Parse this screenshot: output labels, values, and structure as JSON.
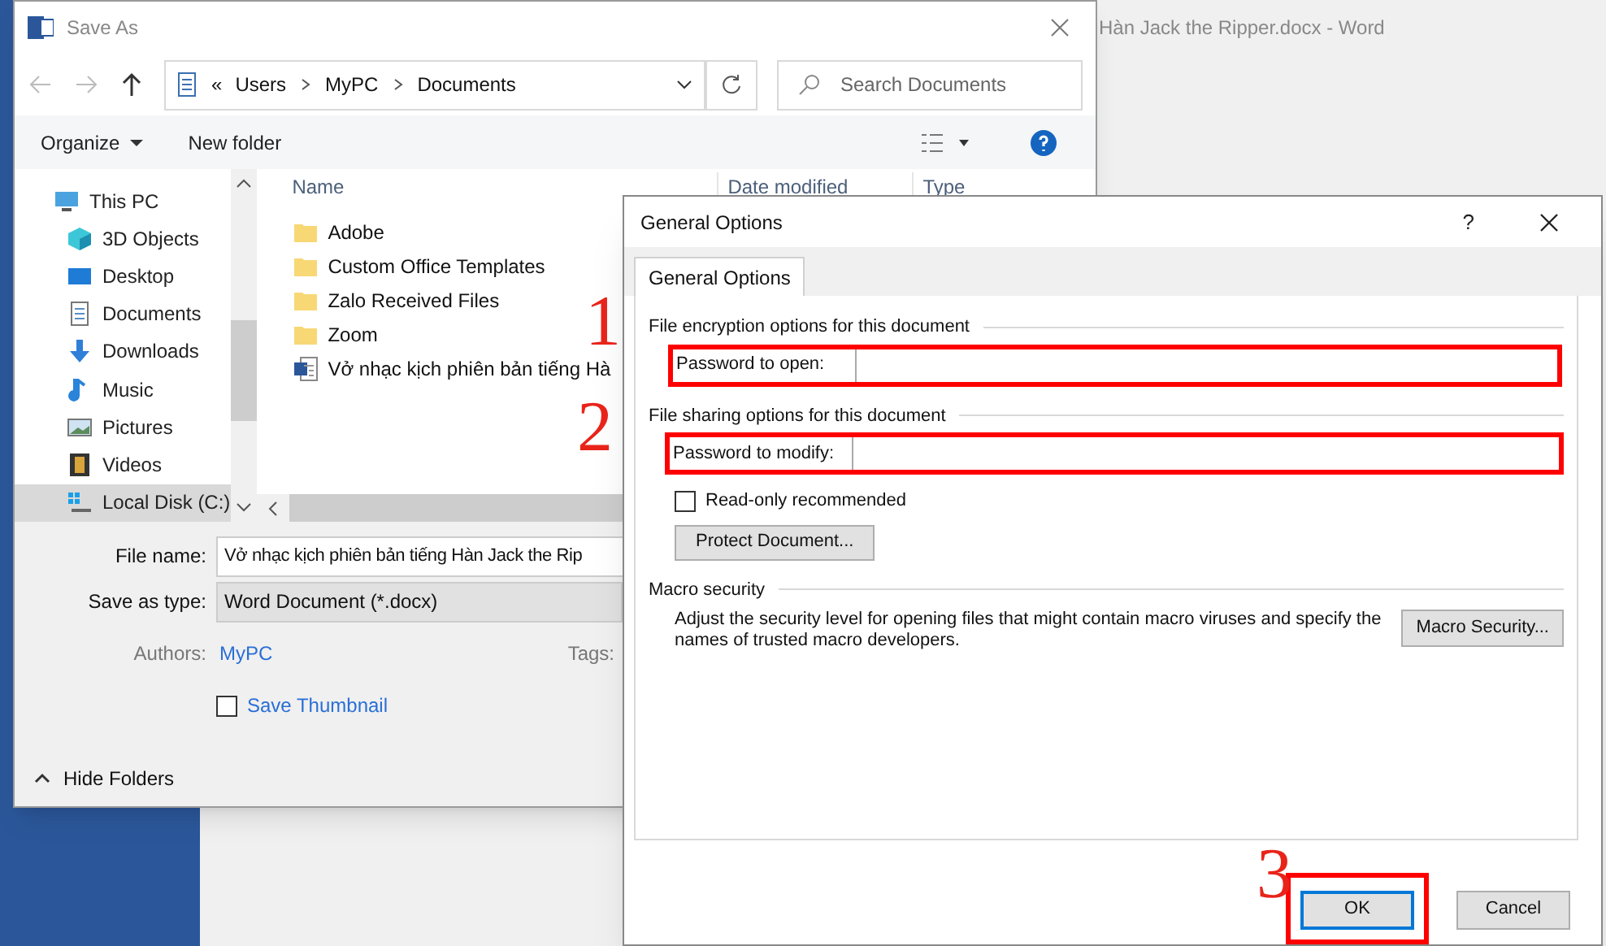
{
  "background_app": {
    "title": "Hàn Jack the Ripper.docx - Word"
  },
  "save_as": {
    "title": "Save As",
    "address": {
      "overflow": "«",
      "crumbs": [
        "Users",
        "MyPC",
        "Documents"
      ]
    },
    "search": {
      "placeholder": "Search Documents"
    },
    "toolbar": {
      "organize": "Organize",
      "new_folder": "New folder"
    },
    "nav_items": [
      {
        "label": "This PC",
        "kind": "pc",
        "selected": false,
        "children": [
          {
            "label": "3D Objects",
            "kind": "cube",
            "selected": false
          },
          {
            "label": "Desktop",
            "kind": "desktop",
            "selected": false
          },
          {
            "label": "Documents",
            "kind": "document",
            "selected": false
          },
          {
            "label": "Downloads",
            "kind": "download",
            "selected": false
          },
          {
            "label": "Music",
            "kind": "music",
            "selected": false
          },
          {
            "label": "Pictures",
            "kind": "picture",
            "selected": false
          },
          {
            "label": "Videos",
            "kind": "video",
            "selected": false
          },
          {
            "label": "Local Disk (C:)",
            "kind": "disk",
            "selected": true
          }
        ]
      }
    ],
    "columns": [
      "Name",
      "Date modified",
      "Type"
    ],
    "files": [
      {
        "name": "Adobe",
        "kind": "folder"
      },
      {
        "name": "Custom Office Templates",
        "kind": "folder"
      },
      {
        "name": "Zalo Received Files",
        "kind": "folder"
      },
      {
        "name": "Zoom",
        "kind": "folder"
      },
      {
        "name": "Vở nhạc kịch phiên bản tiếng Hà",
        "kind": "word"
      }
    ],
    "file_name": {
      "label": "File name:",
      "value": "Vở nhạc kịch phiên bản tiếng Hàn Jack the Rip"
    },
    "save_as_type": {
      "label": "Save as type:",
      "value": "Word Document (*.docx)"
    },
    "authors": {
      "label": "Authors:",
      "value": "MyPC"
    },
    "tags": {
      "label": "Tags:"
    },
    "save_thumbnail": {
      "label": "Save Thumbnail",
      "checked": false
    },
    "hide_folders": {
      "label": "Hide Folders"
    }
  },
  "general_options": {
    "title": "General Options",
    "help": "?",
    "tabs": [
      {
        "label": "General Options",
        "selected": true
      }
    ],
    "encryption": {
      "heading": "File encryption options for this document",
      "password": {
        "label": "Password to open:",
        "highlighted": true
      }
    },
    "sharing": {
      "heading": "File sharing options for this document",
      "password": {
        "label": "Password to modify:",
        "highlighted": true
      },
      "read_only": {
        "label": "Read-only recommended",
        "checked": false
      },
      "protect_button": "Protect Document..."
    },
    "macro": {
      "heading": "Macro security",
      "text": "Adjust the security level for opening files that might contain macro viruses and specify the names of trusted macro developers.",
      "button": "Macro Security..."
    },
    "buttons": [
      {
        "label": "OK",
        "kind": "primary",
        "highlighted": true
      },
      {
        "label": "Cancel",
        "kind": "secondary",
        "highlighted": false
      }
    ]
  },
  "step_markers": [
    "1",
    "2",
    "3"
  ]
}
